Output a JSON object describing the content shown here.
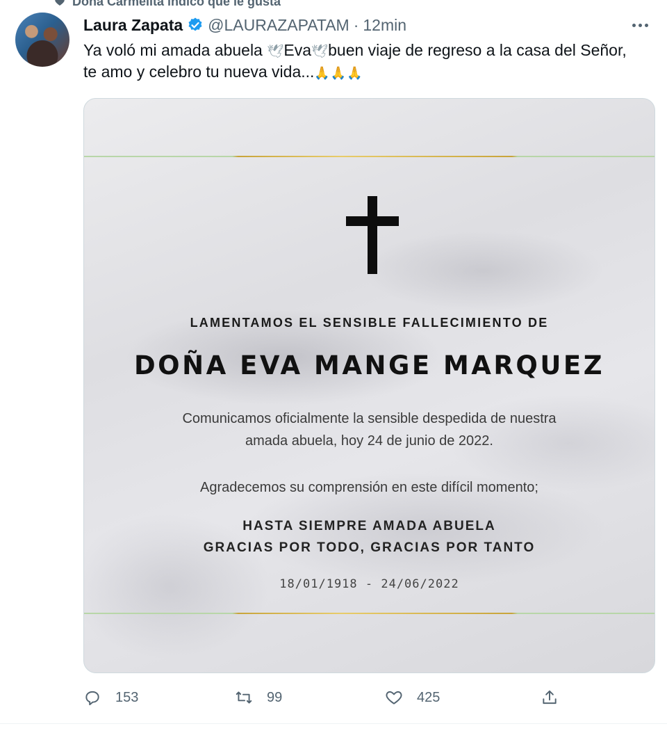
{
  "social_context": {
    "text": "Doña Carmelita indicó que le gusta",
    "icon": "heart-icon"
  },
  "tweet": {
    "author_name": "Laura Zapata",
    "verified_icon": "verified-badge-icon",
    "handle": "@LAURAZAPATAM",
    "separator": "·",
    "time": "12min",
    "text_part1": "Ya voló mi amada abuela ",
    "dove1": "🕊",
    "text_part2": "Eva",
    "dove2": "🕊",
    "text_part3": "buen viaje de regreso a la casa del Señor, te amo y celebro tu nueva vida...",
    "pray_emojis": "🙏🙏🙏"
  },
  "card": {
    "lament": "LAMENTAMOS EL SENSIBLE FALLECIMIENTO DE",
    "deceased_name": "DOÑA EVA MANGE MARQUEZ",
    "message_line1": "Comunicamos oficialmente la sensible despedida de nuestra",
    "message_line2": "amada abuela, hoy 24 de junio de 2022.",
    "thanks": "Agradecemos su comprensión en este difícil momento;",
    "slogan_line1": "HASTA SIEMPRE AMADA ABUELA",
    "slogan_line2": "GRACIAS POR TODO, GRACIAS POR TANTO",
    "dates": "18/01/1918 - 24/06/2022"
  },
  "actions": {
    "reply_count": "153",
    "retweet_count": "99",
    "like_count": "425"
  },
  "colors": {
    "accent": "#1d9bf0",
    "secondary_text": "#536471",
    "gold": "#d4b24c"
  }
}
